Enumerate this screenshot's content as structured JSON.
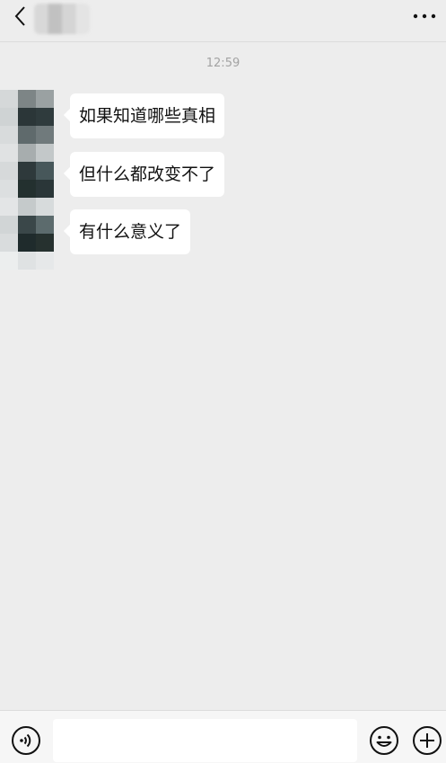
{
  "header": {
    "back_icon": "chevron-left-icon",
    "more_icon": "more-dots-icon"
  },
  "chat": {
    "timestamp": "12:59",
    "messages": [
      {
        "text": "如果知道哪些真相",
        "sender": "contact"
      },
      {
        "text": "但什么都改变不了",
        "sender": "contact"
      },
      {
        "text": "有什么意义了",
        "sender": "contact"
      }
    ]
  },
  "input_bar": {
    "voice_icon": "voice-icon",
    "emoji_icon": "emoji-icon",
    "plus_icon": "plus-icon",
    "placeholder": ""
  },
  "colors": {
    "background": "#ededed",
    "bubble": "#ffffff",
    "timestamp": "#a3a3a3"
  }
}
